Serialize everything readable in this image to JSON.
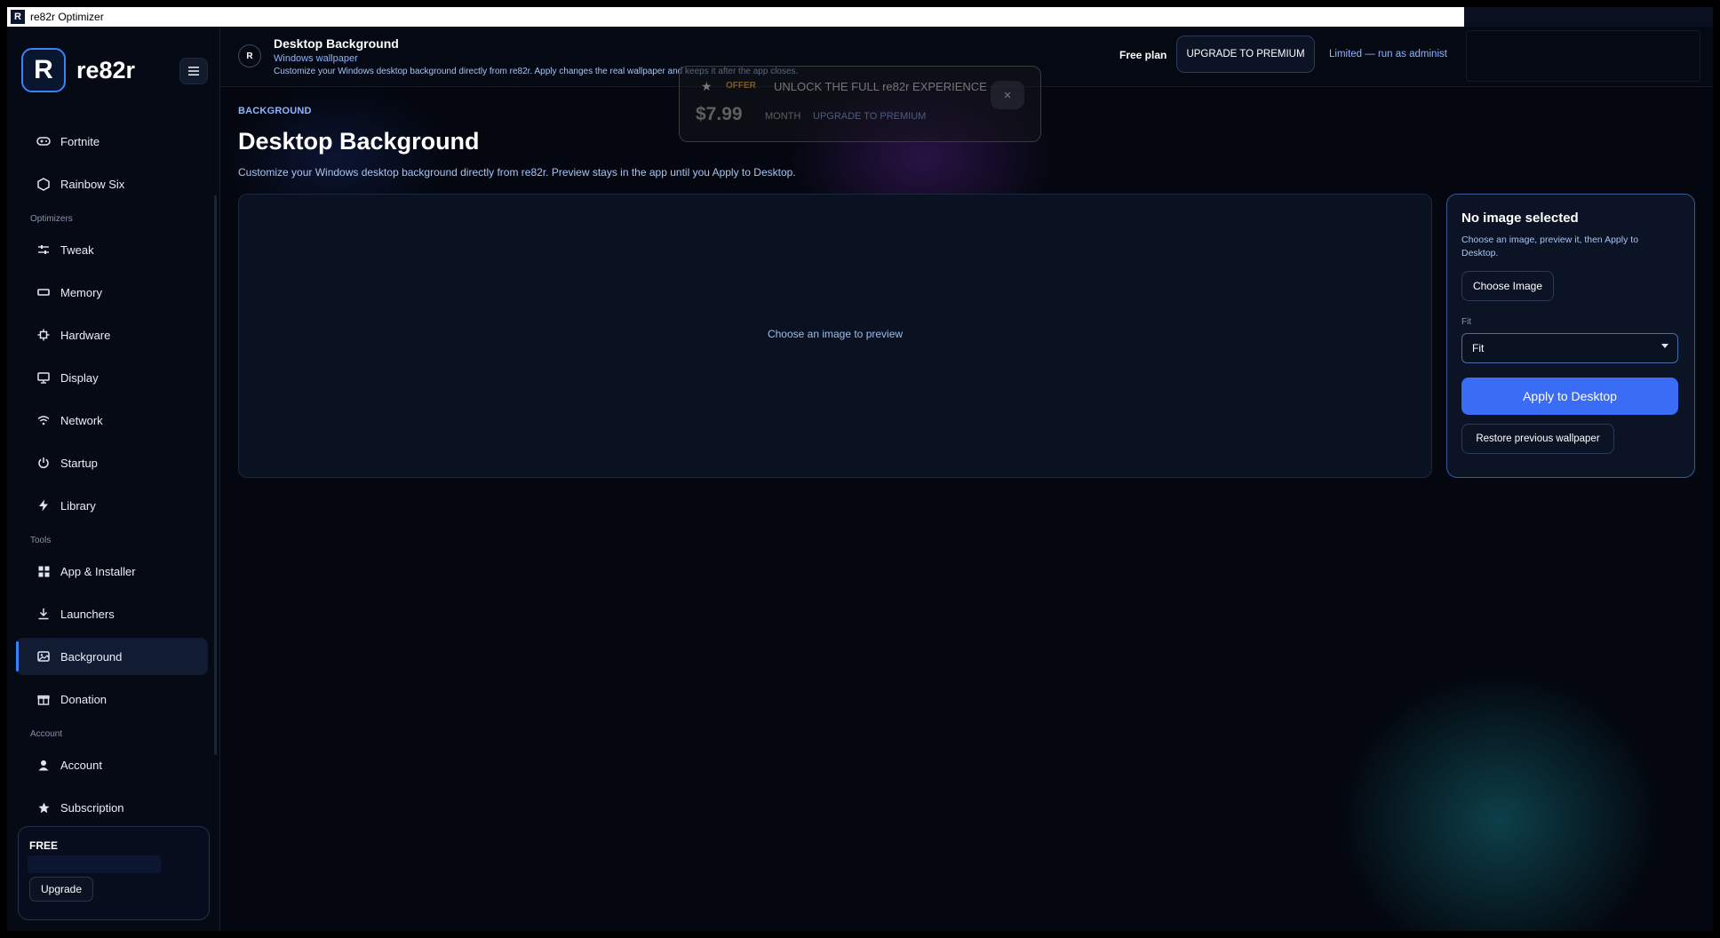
{
  "window": {
    "title": "re82r Optimizer",
    "app_icon": "R"
  },
  "brand": {
    "logo": "R",
    "name": "re82r",
    "menu_icon": "hamburger-icon"
  },
  "sidebar": {
    "top_items": [
      {
        "label": "Fortnite",
        "icon": "gamepad-icon"
      },
      {
        "label": "Rainbow Six",
        "icon": "hexagon-icon"
      }
    ],
    "sections": [
      {
        "label": "Optimizers",
        "items": [
          {
            "label": "Tweak",
            "icon": "sliders-icon"
          },
          {
            "label": "Memory",
            "icon": "memory-icon"
          },
          {
            "label": "Hardware",
            "icon": "chip-icon"
          },
          {
            "label": "Display",
            "icon": "monitor-icon"
          },
          {
            "label": "Network",
            "icon": "wifi-icon"
          },
          {
            "label": "Startup",
            "icon": "power-icon"
          },
          {
            "label": "Library",
            "icon": "bolt-icon"
          }
        ]
      },
      {
        "label": "Tools",
        "items": [
          {
            "label": "App & Installer",
            "icon": "grid-icon"
          },
          {
            "label": "Launchers",
            "icon": "download-icon"
          },
          {
            "label": "Background",
            "icon": "image-icon",
            "active": true
          },
          {
            "label": "Donation",
            "icon": "gift-icon"
          }
        ]
      },
      {
        "label": "Account",
        "items": [
          {
            "label": "Account",
            "icon": "user-icon"
          },
          {
            "label": "Subscription",
            "icon": "star-icon"
          }
        ]
      }
    ],
    "plan_card": {
      "name": "FREE",
      "upgrade_label": "Upgrade"
    }
  },
  "header": {
    "avatar": "R",
    "title": "Desktop Background",
    "subtitle": "Windows wallpaper",
    "description": "Customize your Windows desktop background directly from re82r. Apply changes the real wallpaper and keeps it after the app closes.",
    "plan": "Free plan",
    "upgrade_label": "UPGRADE TO PREMIUM",
    "limited": "Limited — run as administ"
  },
  "offer": {
    "star": "★",
    "badge": "OFFER",
    "headline": "UNLOCK THE FULL re82r EXPERIENCE",
    "price": "$7.99",
    "period": "MONTH",
    "cta": "UPGRADE TO PREMIUM",
    "close": "×"
  },
  "main": {
    "eyebrow": "BACKGROUND",
    "title": "Desktop Background",
    "description": "Customize your Windows desktop background directly from re82r. Preview stays in the app until you Apply to Desktop.",
    "preview_empty": "Choose an image to preview",
    "panel": {
      "title": "No image selected",
      "description": "Choose an image, preview it, then Apply to Desktop.",
      "choose_label": "Choose Image",
      "fit_label": "Fit",
      "fit_value": "Fit",
      "apply_label": "Apply to Desktop",
      "restore_label": "Restore previous wallpaper"
    }
  },
  "colors": {
    "accent": "#3b6cf6",
    "background": "#04070f",
    "sidebar": "#060a14",
    "panel_border": "#3a5a9a"
  }
}
